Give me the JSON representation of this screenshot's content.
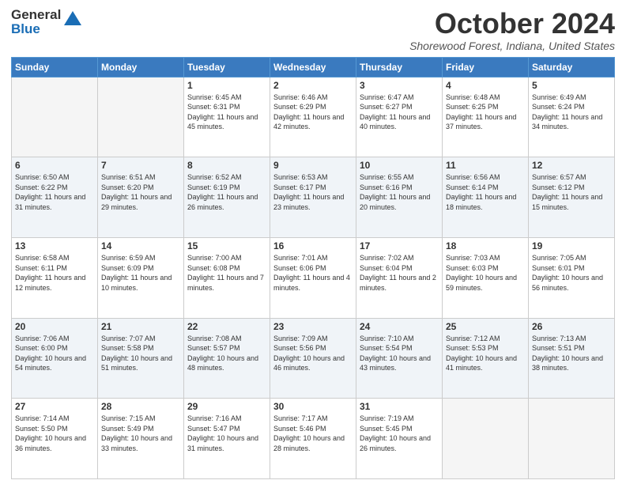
{
  "header": {
    "logo_general": "General",
    "logo_blue": "Blue",
    "month_title": "October 2024",
    "location": "Shorewood Forest, Indiana, United States"
  },
  "days_of_week": [
    "Sunday",
    "Monday",
    "Tuesday",
    "Wednesday",
    "Thursday",
    "Friday",
    "Saturday"
  ],
  "weeks": [
    [
      {
        "day": "",
        "info": ""
      },
      {
        "day": "",
        "info": ""
      },
      {
        "day": "1",
        "info": "Sunrise: 6:45 AM\nSunset: 6:31 PM\nDaylight: 11 hours and 45 minutes."
      },
      {
        "day": "2",
        "info": "Sunrise: 6:46 AM\nSunset: 6:29 PM\nDaylight: 11 hours and 42 minutes."
      },
      {
        "day": "3",
        "info": "Sunrise: 6:47 AM\nSunset: 6:27 PM\nDaylight: 11 hours and 40 minutes."
      },
      {
        "day": "4",
        "info": "Sunrise: 6:48 AM\nSunset: 6:25 PM\nDaylight: 11 hours and 37 minutes."
      },
      {
        "day": "5",
        "info": "Sunrise: 6:49 AM\nSunset: 6:24 PM\nDaylight: 11 hours and 34 minutes."
      }
    ],
    [
      {
        "day": "6",
        "info": "Sunrise: 6:50 AM\nSunset: 6:22 PM\nDaylight: 11 hours and 31 minutes."
      },
      {
        "day": "7",
        "info": "Sunrise: 6:51 AM\nSunset: 6:20 PM\nDaylight: 11 hours and 29 minutes."
      },
      {
        "day": "8",
        "info": "Sunrise: 6:52 AM\nSunset: 6:19 PM\nDaylight: 11 hours and 26 minutes."
      },
      {
        "day": "9",
        "info": "Sunrise: 6:53 AM\nSunset: 6:17 PM\nDaylight: 11 hours and 23 minutes."
      },
      {
        "day": "10",
        "info": "Sunrise: 6:55 AM\nSunset: 6:16 PM\nDaylight: 11 hours and 20 minutes."
      },
      {
        "day": "11",
        "info": "Sunrise: 6:56 AM\nSunset: 6:14 PM\nDaylight: 11 hours and 18 minutes."
      },
      {
        "day": "12",
        "info": "Sunrise: 6:57 AM\nSunset: 6:12 PM\nDaylight: 11 hours and 15 minutes."
      }
    ],
    [
      {
        "day": "13",
        "info": "Sunrise: 6:58 AM\nSunset: 6:11 PM\nDaylight: 11 hours and 12 minutes."
      },
      {
        "day": "14",
        "info": "Sunrise: 6:59 AM\nSunset: 6:09 PM\nDaylight: 11 hours and 10 minutes."
      },
      {
        "day": "15",
        "info": "Sunrise: 7:00 AM\nSunset: 6:08 PM\nDaylight: 11 hours and 7 minutes."
      },
      {
        "day": "16",
        "info": "Sunrise: 7:01 AM\nSunset: 6:06 PM\nDaylight: 11 hours and 4 minutes."
      },
      {
        "day": "17",
        "info": "Sunrise: 7:02 AM\nSunset: 6:04 PM\nDaylight: 11 hours and 2 minutes."
      },
      {
        "day": "18",
        "info": "Sunrise: 7:03 AM\nSunset: 6:03 PM\nDaylight: 10 hours and 59 minutes."
      },
      {
        "day": "19",
        "info": "Sunrise: 7:05 AM\nSunset: 6:01 PM\nDaylight: 10 hours and 56 minutes."
      }
    ],
    [
      {
        "day": "20",
        "info": "Sunrise: 7:06 AM\nSunset: 6:00 PM\nDaylight: 10 hours and 54 minutes."
      },
      {
        "day": "21",
        "info": "Sunrise: 7:07 AM\nSunset: 5:58 PM\nDaylight: 10 hours and 51 minutes."
      },
      {
        "day": "22",
        "info": "Sunrise: 7:08 AM\nSunset: 5:57 PM\nDaylight: 10 hours and 48 minutes."
      },
      {
        "day": "23",
        "info": "Sunrise: 7:09 AM\nSunset: 5:56 PM\nDaylight: 10 hours and 46 minutes."
      },
      {
        "day": "24",
        "info": "Sunrise: 7:10 AM\nSunset: 5:54 PM\nDaylight: 10 hours and 43 minutes."
      },
      {
        "day": "25",
        "info": "Sunrise: 7:12 AM\nSunset: 5:53 PM\nDaylight: 10 hours and 41 minutes."
      },
      {
        "day": "26",
        "info": "Sunrise: 7:13 AM\nSunset: 5:51 PM\nDaylight: 10 hours and 38 minutes."
      }
    ],
    [
      {
        "day": "27",
        "info": "Sunrise: 7:14 AM\nSunset: 5:50 PM\nDaylight: 10 hours and 36 minutes."
      },
      {
        "day": "28",
        "info": "Sunrise: 7:15 AM\nSunset: 5:49 PM\nDaylight: 10 hours and 33 minutes."
      },
      {
        "day": "29",
        "info": "Sunrise: 7:16 AM\nSunset: 5:47 PM\nDaylight: 10 hours and 31 minutes."
      },
      {
        "day": "30",
        "info": "Sunrise: 7:17 AM\nSunset: 5:46 PM\nDaylight: 10 hours and 28 minutes."
      },
      {
        "day": "31",
        "info": "Sunrise: 7:19 AM\nSunset: 5:45 PM\nDaylight: 10 hours and 26 minutes."
      },
      {
        "day": "",
        "info": ""
      },
      {
        "day": "",
        "info": ""
      }
    ]
  ]
}
